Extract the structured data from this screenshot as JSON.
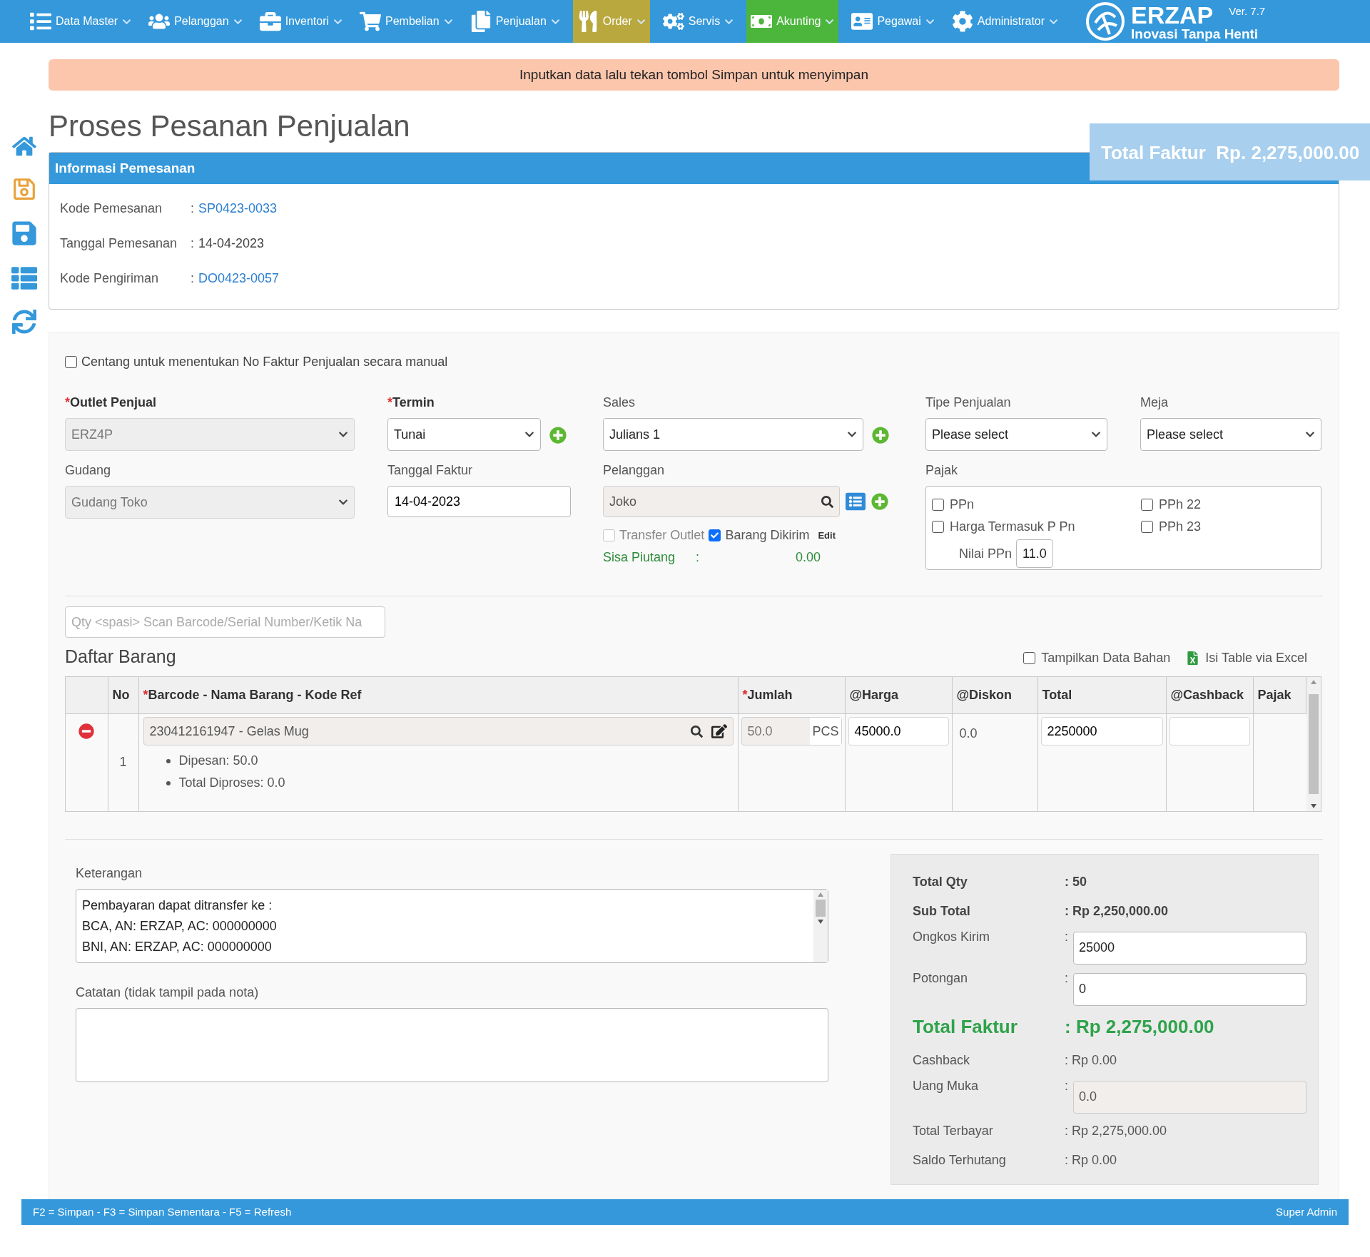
{
  "nav": {
    "items": [
      {
        "label": "Data Master",
        "color": "#3498db"
      },
      {
        "label": "Pelanggan",
        "color": "#3498db"
      },
      {
        "label": "Inventori",
        "color": "#3498db"
      },
      {
        "label": "Pembelian",
        "color": "#3498db"
      },
      {
        "label": "Penjualan",
        "color": "#3498db"
      },
      {
        "label": "Order",
        "color": "#b9a83e"
      },
      {
        "label": "Servis",
        "color": "#3498db"
      },
      {
        "label": "Akunting",
        "color": "#4cb63c"
      },
      {
        "label": "Pegawai",
        "color": "#3498db"
      },
      {
        "label": "Administrator",
        "color": "#3498db"
      }
    ],
    "brand": {
      "name": "ERZAP",
      "tagline": "Inovasi Tanpa Henti",
      "version": "Ver. 7.7"
    }
  },
  "alert": "Inputkan data lalu tekan tombol Simpan untuk menyimpan",
  "title": "Proses Pesanan Penjualan",
  "total_badge": {
    "label": "Total Faktur",
    "value": "Rp. 2,275,000.00"
  },
  "info_panel": {
    "title": "Informasi Pemesanan",
    "rows": [
      {
        "label": "Kode Pemesanan",
        "colon": ":",
        "value": "SP0423-0033",
        "kind": "link"
      },
      {
        "label": "Tanggal Pemesanan",
        "colon": ":",
        "value": "14-04-2023",
        "kind": "text"
      },
      {
        "label": "Kode Pengiriman",
        "colon": ":",
        "value": "DO0423-0057",
        "kind": "link"
      }
    ]
  },
  "required_mark": "*",
  "manual_invoice": {
    "label": "Centang untuk menentukan No Faktur Penjualan secara manual",
    "checked": false
  },
  "outlet": {
    "label": "Outlet Penjual",
    "required": true,
    "value": "ERZ4P",
    "disabled": true
  },
  "termin": {
    "label": "Termin",
    "required": true,
    "value": "Tunai",
    "disabled": false
  },
  "sales": {
    "label": "Sales",
    "required": false,
    "value": "Julians 1",
    "disabled": false
  },
  "sale_type": {
    "label": "Tipe Penjualan",
    "required": false,
    "value": "Please select",
    "disabled": false
  },
  "table_select": {
    "label": "Meja",
    "required": false,
    "value": "Please select",
    "disabled": false
  },
  "warehouse": {
    "label": "Gudang",
    "required": false,
    "value": "Gudang Toko",
    "disabled": true
  },
  "invoice_date": {
    "label": "Tanggal Faktur",
    "value": "14-04-2023"
  },
  "customer": {
    "label": "Pelanggan",
    "value": "Joko"
  },
  "transfer_outlet": {
    "label": "Transfer Outlet",
    "checked": false,
    "disabled": true
  },
  "goods_sent": {
    "label": "Barang Dikirim",
    "checked": true
  },
  "edit_link": "Edit",
  "receivable": {
    "label": "Sisa Piutang",
    "colon": ":",
    "value": "0.00"
  },
  "tax": {
    "label": "Pajak",
    "options": [
      {
        "label": "PPn",
        "checked": false
      },
      {
        "label": "PPh 22",
        "checked": false
      },
      {
        "label": "Harga Termasuk P Pn",
        "checked": false
      },
      {
        "label": "PPh 23",
        "checked": false
      }
    ],
    "ppn_label": "Nilai PPn",
    "ppn_value": "11.0"
  },
  "scan": {
    "placeholder": "Qty <spasi> Scan Barcode/Serial Number/Ketik Na"
  },
  "items_title": "Daftar Barang",
  "show_materials": {
    "label": "Tampilkan Data Bahan",
    "checked": false
  },
  "excel_link": "Isi Table via Excel",
  "table": {
    "columns": [
      {
        "label": "No",
        "required": false
      },
      {
        "label": "Barcode - Nama Barang - Kode Ref",
        "required": true
      },
      {
        "label": "Jumlah",
        "required": true
      },
      {
        "label": "@Harga",
        "required": false
      },
      {
        "label": "@Diskon",
        "required": false
      },
      {
        "label": "Total",
        "required": false
      },
      {
        "label": "@Cashback",
        "required": false
      },
      {
        "label": "Pajak",
        "required": false
      }
    ],
    "rows": [
      {
        "no": "1",
        "item": "230412161947 - Gelas Mug",
        "details": [
          "Dipesan: 50.0",
          "Total Diproses: 0.0"
        ],
        "qty": "50.0",
        "unit": "PCS",
        "price": "45000.0",
        "discount": "0.0",
        "total": "2250000"
      }
    ]
  },
  "notes": {
    "label": "Keterangan",
    "value": "Pembayaran dapat ditransfer ke :\nBCA, AN: ERZAP, AC: 000000000\nBNI, AN: ERZAP, AC: 000000000"
  },
  "memo": {
    "label": "Catatan (tidak tampil pada nota)"
  },
  "summary": [
    {
      "kind": "bold",
      "label": "Total Qty",
      "value": ": 50"
    },
    {
      "kind": "bold",
      "label": "Sub Total",
      "value": ": Rp 2,250,000.00"
    },
    {
      "kind": "input",
      "label": "Ongkos Kirim",
      "colon": ":",
      "value": "25000"
    },
    {
      "kind": "input",
      "label": "Potongan",
      "colon": ":",
      "value": "0"
    },
    {
      "kind": "total",
      "label": "Total Faktur",
      "value": ": Rp 2,275,000.00"
    },
    {
      "kind": "plain",
      "label": "Cashback",
      "value": ": Rp 0.00"
    },
    {
      "kind": "readonly",
      "label": "Uang Muka",
      "colon": ":",
      "value": "0.0"
    },
    {
      "kind": "plain",
      "label": "Total Terbayar",
      "value": ": Rp 2,275,000.00"
    },
    {
      "kind": "plain",
      "label": "Saldo Terhutang",
      "value": ": Rp 0.00"
    }
  ],
  "footer": {
    "shortcuts": "F2 = Simpan - F3 = Simpan Sementara - F5 = Refresh",
    "user": "Super Admin"
  }
}
